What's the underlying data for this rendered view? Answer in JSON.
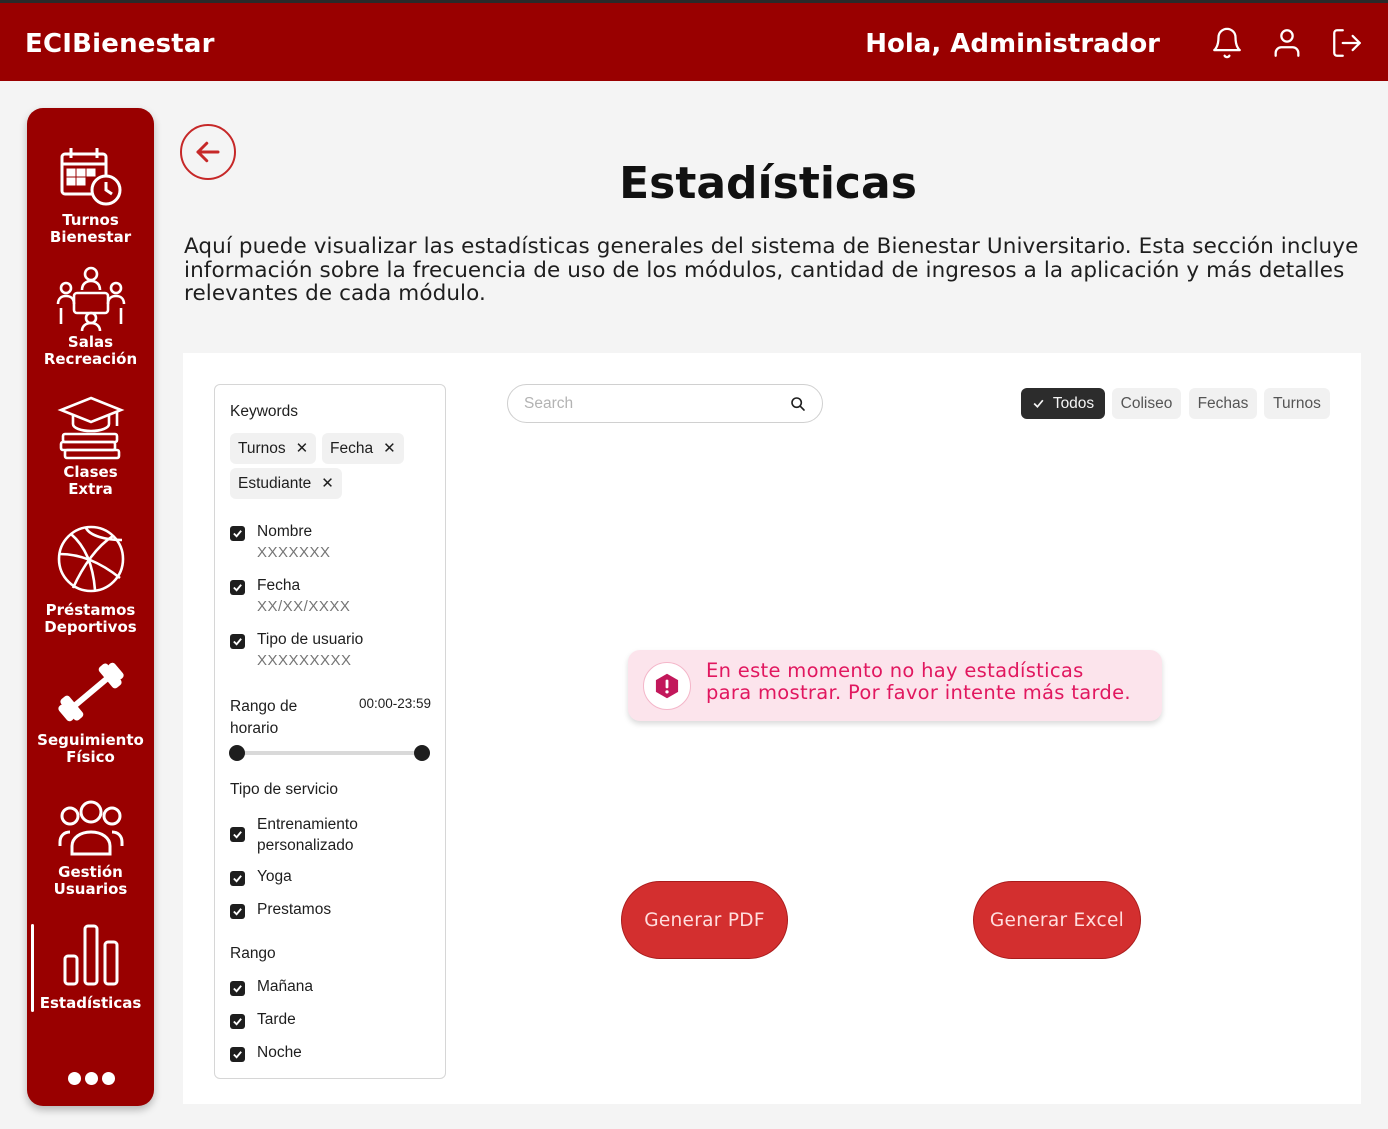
{
  "header": {
    "brand": "ECIBienestar",
    "greeting": "Hola, Administrador",
    "icons": [
      "bell-icon",
      "user-icon",
      "logout-icon"
    ]
  },
  "sidebar": {
    "items": [
      {
        "label_line1": "Turnos",
        "label_line2": "Bienestar",
        "icon": "calendar-clock-icon"
      },
      {
        "label_line1": "Salas",
        "label_line2": "Recreación",
        "icon": "meeting-room-icon"
      },
      {
        "label_line1": "Clases",
        "label_line2": "Extra",
        "icon": "books-graduation-icon"
      },
      {
        "label_line1": "Préstamos",
        "label_line2": "Deportivos",
        "icon": "basketball-icon"
      },
      {
        "label_line1": "Seguimiento",
        "label_line2": "Físico",
        "icon": "dumbbell-icon"
      },
      {
        "label_line1": "Gestión",
        "label_line2": "Usuarios",
        "icon": "users-group-icon"
      },
      {
        "label_line1": "Estadísticas",
        "label_line2": "",
        "icon": "bar-chart-icon",
        "active": true
      }
    ],
    "more_icon": "more-dots-icon"
  },
  "main": {
    "title": "Estadísticas",
    "description": "Aquí puede visualizar las estadísticas generales del sistema de Bienestar Universitario. Esta sección incluye información sobre la frecuencia de uso de los módulos, cantidad de ingresos a la aplicación y más detalles relevantes de cada módulo."
  },
  "filters": {
    "keywords_title": "Keywords",
    "chips": [
      "Turnos",
      "Fecha",
      "Estudiante"
    ],
    "fields": [
      {
        "label": "Nombre",
        "value": "XXXXXXX",
        "checked": true
      },
      {
        "label": "Fecha",
        "value": "XX/XX/XXXX",
        "checked": true
      },
      {
        "label": "Tipo de usuario",
        "value": "XXXXXXXXX",
        "checked": true
      }
    ],
    "range_label_line1": "Rango de",
    "range_label_line2": "horario",
    "range_value": "00:00-23:59",
    "service_title": "Tipo de servicio",
    "services": [
      {
        "label_line1": "Entrenamiento",
        "label_line2": "personalizado",
        "checked": true
      },
      {
        "label_line1": "Yoga",
        "label_line2": "",
        "checked": true
      },
      {
        "label_line1": "Prestamos",
        "label_line2": "",
        "checked": true
      }
    ],
    "rango_title": "Rango",
    "rangos": [
      {
        "label": "Mañana",
        "checked": true
      },
      {
        "label": "Tarde",
        "checked": true
      },
      {
        "label": "Noche",
        "checked": true
      }
    ]
  },
  "search": {
    "placeholder": "Search"
  },
  "tags": [
    {
      "label": "Todos",
      "active": true
    },
    {
      "label": "Coliseo",
      "active": false
    },
    {
      "label": "Fechas",
      "active": false
    },
    {
      "label": "Turnos",
      "active": false
    }
  ],
  "alert": {
    "line1": "En este momento no hay estadísticas",
    "line2": "para mostrar. Por favor intente más tarde."
  },
  "actions": {
    "pdf": "Generar PDF",
    "excel": "Generar Excel"
  },
  "colors": {
    "primary": "#990000",
    "button": "#d32f2f",
    "alert_bg": "#fce4ec",
    "alert_text": "#e1175f"
  }
}
